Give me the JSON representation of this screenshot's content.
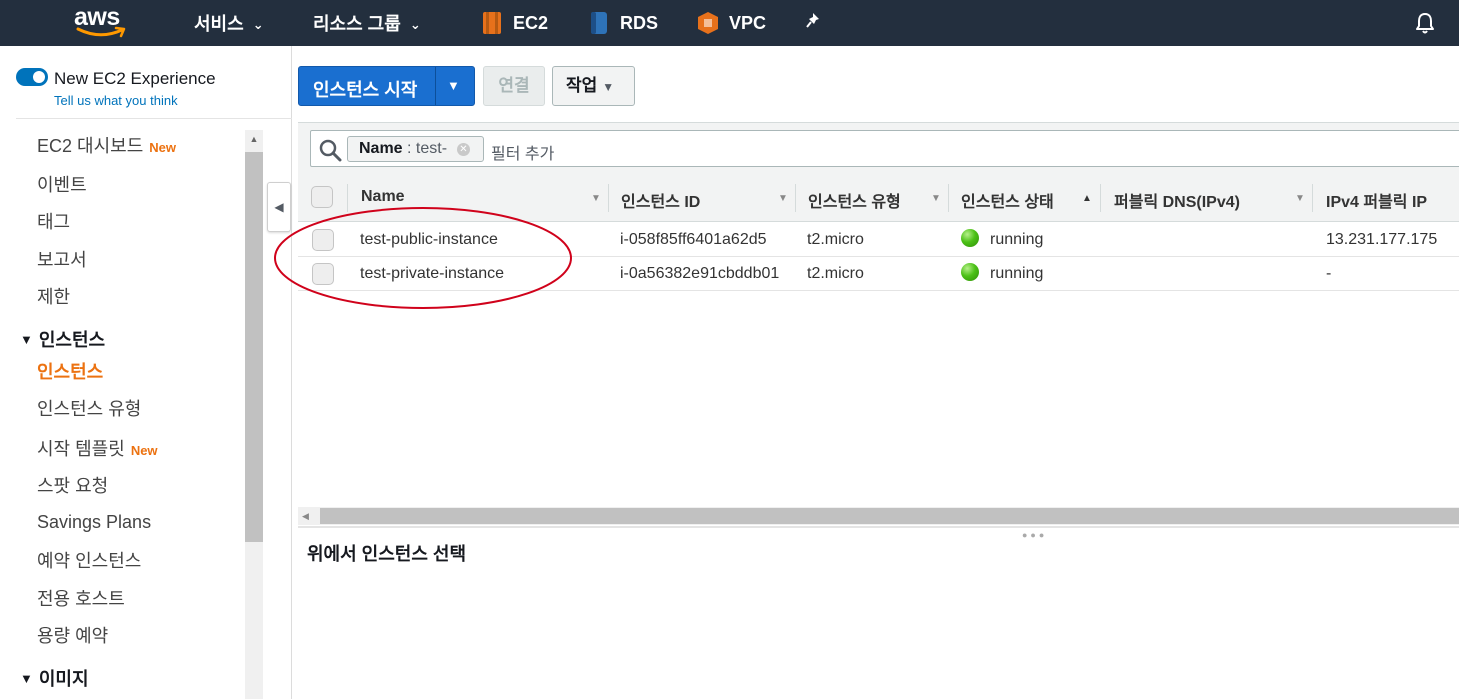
{
  "topnav": {
    "logo_text": "aws",
    "services_label": "서비스",
    "resource_groups_label": "리소스 그룹",
    "shortcuts": [
      {
        "label": "EC2",
        "icon": "ec2-icon",
        "color": "#e7711b"
      },
      {
        "label": "RDS",
        "icon": "rds-icon",
        "color": "#2e73b8"
      },
      {
        "label": "VPC",
        "icon": "vpc-icon",
        "color": "#e7711b"
      }
    ]
  },
  "sidebar": {
    "new_experience_label": "New EC2 Experience",
    "tell_us_label": "Tell us what you think",
    "items": [
      {
        "label": "EC2 대시보드",
        "badge": "New"
      },
      {
        "label": "이벤트"
      },
      {
        "label": "태그"
      },
      {
        "label": "보고서"
      },
      {
        "label": "제한"
      }
    ],
    "section_instances": "인스턴스",
    "instance_items": [
      {
        "label": "인스턴스",
        "active": true
      },
      {
        "label": "인스턴스 유형"
      },
      {
        "label": "시작 템플릿",
        "badge": "New"
      },
      {
        "label": "스팟 요청"
      },
      {
        "label": "Savings Plans"
      },
      {
        "label": "예약 인스턴스"
      },
      {
        "label": "전용 호스트"
      },
      {
        "label": "용량 예약"
      }
    ],
    "section_images": "이미지"
  },
  "toolbar": {
    "launch_label": "인스턴스 시작",
    "connect_label": "연결",
    "actions_label": "작업"
  },
  "filter": {
    "token_key": "Name",
    "token_sep": " : ",
    "token_value": "test-",
    "placeholder": "필터 추가"
  },
  "table": {
    "columns": [
      "Name",
      "인스턴스 ID",
      "인스턴스 유형",
      "인스턴스 상태",
      "퍼블릭 DNS(IPv4)",
      "IPv4 퍼블릭 IP"
    ],
    "rows": [
      {
        "name": "test-public-instance",
        "id": "i-058f85ff6401a62d5",
        "type": "t2.micro",
        "state": "running",
        "dns": "",
        "ip": "13.231.177.175"
      },
      {
        "name": "test-private-instance",
        "id": "i-0a56382e91cbddb01",
        "type": "t2.micro",
        "state": "running",
        "dns": "",
        "ip": "-"
      }
    ]
  },
  "details": {
    "title": "위에서 인스턴스 선택"
  },
  "colors": {
    "topnav_bg": "#232f3e",
    "primary_button": "#1a6fd0",
    "active_orange": "#ec7211",
    "link_blue": "#0073bb",
    "annotation_red": "#d0021b",
    "running_green": "#4cc117"
  }
}
